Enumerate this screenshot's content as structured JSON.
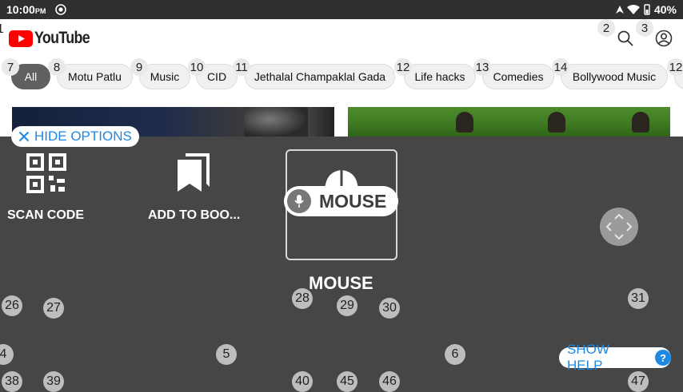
{
  "status_bar": {
    "time": "10:00",
    "ampm": "PM",
    "battery": "40%"
  },
  "header": {
    "wordmark": "YouTube"
  },
  "chips": [
    {
      "label": "All",
      "active": true
    },
    {
      "label": "Motu Patlu"
    },
    {
      "label": "Music"
    },
    {
      "label": "CID"
    },
    {
      "label": "Jethalal Champaklal Gada"
    },
    {
      "label": "Life hacks"
    },
    {
      "label": "Comedies"
    },
    {
      "label": "Bollywood Music"
    }
  ],
  "overlay": {
    "hide_options": "HIDE OPTIONS",
    "scan_code": "SCAN CODE",
    "add_to_bookmarks": "ADD TO BOO...",
    "mouse_pill": "MOUSE",
    "mouse_caption": "MOUSE",
    "show_help": "SHOW HELP",
    "help_glyph": "?"
  },
  "badges": {
    "b1": "1",
    "b2": "2",
    "b3": "3",
    "b4": "4",
    "b5": "5",
    "b6": "6",
    "b7": "7",
    "b8": "8",
    "b9": "9",
    "b10": "10",
    "b11": "11",
    "b12": "12",
    "b13": "13",
    "b14": "14",
    "b12b": "12",
    "b26": "26",
    "b27": "27",
    "b28": "28",
    "b29": "29",
    "b30": "30",
    "b31": "31",
    "b38": "38",
    "b39": "39",
    "b40": "40",
    "b45": "45",
    "b46": "46",
    "b47": "47"
  }
}
